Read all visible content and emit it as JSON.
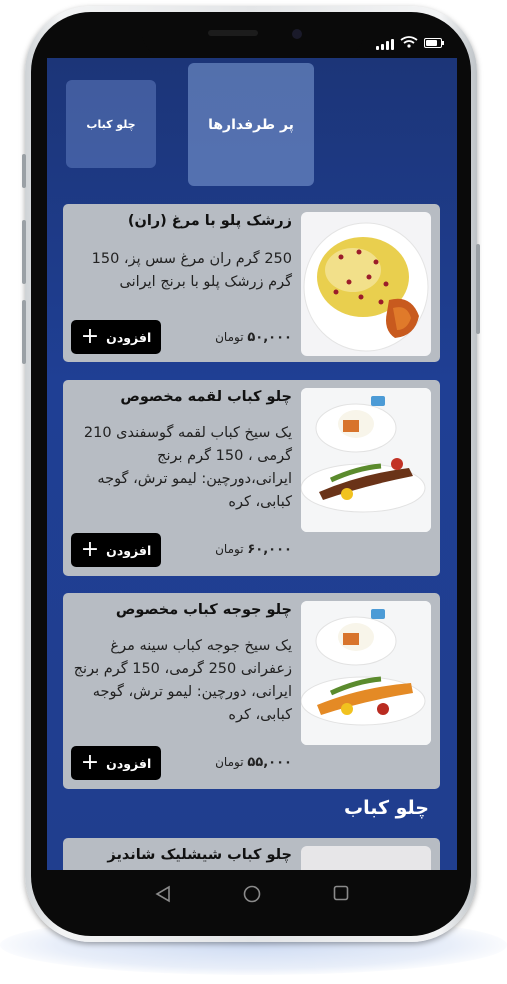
{
  "tabs": [
    {
      "label": "پر طرفدارها"
    },
    {
      "label": "چلو کباب"
    }
  ],
  "items": [
    {
      "title": "زرشک پلو با مرغ (ران)",
      "description": "250 گرم ران مرغ سس پز، 150 گرم زرشک پلو با برنج ایرانی",
      "price": "۵۰,۰۰۰",
      "currency": "تومان",
      "add_label": "افزودن",
      "image_icon": "saffron-rice-with-chicken-icon"
    },
    {
      "title": "چلو کباب لقمه مخصوص",
      "description": "یک سیخ کباب لقمه گوسفندی 210 گرمی ، 150 گرم برنج ایرانی،دورچین: لیمو ترش، گوجه کبابی، کره",
      "price": "۶۰,۰۰۰",
      "currency": "تومان",
      "add_label": "افزودن",
      "image_icon": "kebab-plate-icon"
    },
    {
      "title": "چلو جوجه کباب مخصوص",
      "description": "یک سیخ جوجه کباب سینه مرغ زعفرانی 250 گرمی، 150 گرم برنج ایرانی، دورچین: لیمو ترش، گوجه کبابی، کره",
      "price": "۵۵,۰۰۰",
      "currency": "تومان",
      "add_label": "افزودن",
      "image_icon": "chicken-kebab-plate-icon"
    },
    {
      "title": "چلو کباب شیشلیک شاندیز"
    }
  ],
  "section": {
    "title": "چلو کباب"
  },
  "colors": {
    "screen_bg": "#1f3f94",
    "card_bg": "#b7bcc3",
    "button_bg": "#000000"
  }
}
